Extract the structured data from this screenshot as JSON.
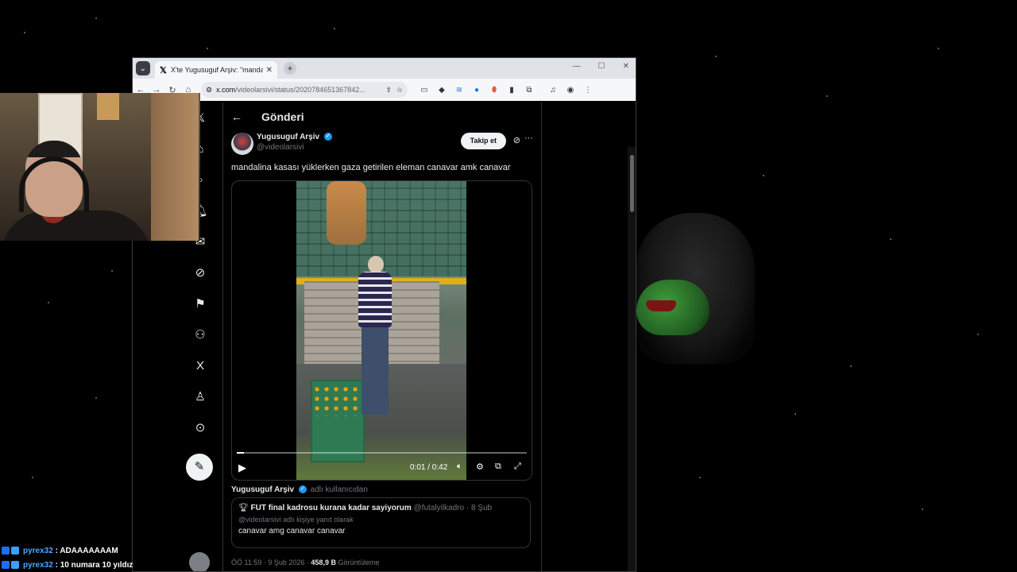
{
  "browser": {
    "tab_title": "X'te Yugusuguf Arşiv: \"mandali",
    "url_host": "x.com",
    "url_path": "/videolarsivi/status/2020784651367842..."
  },
  "page": {
    "header_title": "Gönderi"
  },
  "tweet": {
    "author_name": "Yugusuguf Arşiv",
    "author_handle": "@videolarsivi",
    "follow_label": "Takip et",
    "text": "mandalina kasası yüklerken gaza getirilen eleman canavar amk canavar",
    "video": {
      "time_label": "0:01 / 0:42",
      "progress": 0.024
    },
    "reply_author_name": "Yugusuguf Arşiv",
    "reply_author_suffix": "adlı kullanıcıdan",
    "quote": {
      "name": "FUT final kadrosu kurana kadar sayiyorum",
      "handle": "@futalyilkadro",
      "date": "· 8 Şub",
      "reply_to": "@videolarsivi adlı kişiye yanıt olarak",
      "text": "canavar amg canavar canavar"
    },
    "stats_time": "ÖÖ 11:59 · 9 Şub 2026 ·",
    "stats_views": "458,9 B",
    "stats_views_label": "Görüntüleme"
  },
  "chat": [
    {
      "user": "pyrex32",
      "message": ": ADAAAAAAAM"
    },
    {
      "user": "pyrex32",
      "message": ": 10 numara 10 yıldız"
    }
  ],
  "icons": {
    "nav": [
      "x-logo-icon",
      "home-icon",
      "search-icon",
      "notifications-icon",
      "messages-icon",
      "grok-icon",
      "bookmarks-icon",
      "communities-icon",
      "premium-icon",
      "profile-icon",
      "more-icon"
    ]
  },
  "colors": {
    "verified": "#1d9bf0",
    "background": "#000000",
    "chat_user": "#4aa8ff"
  }
}
